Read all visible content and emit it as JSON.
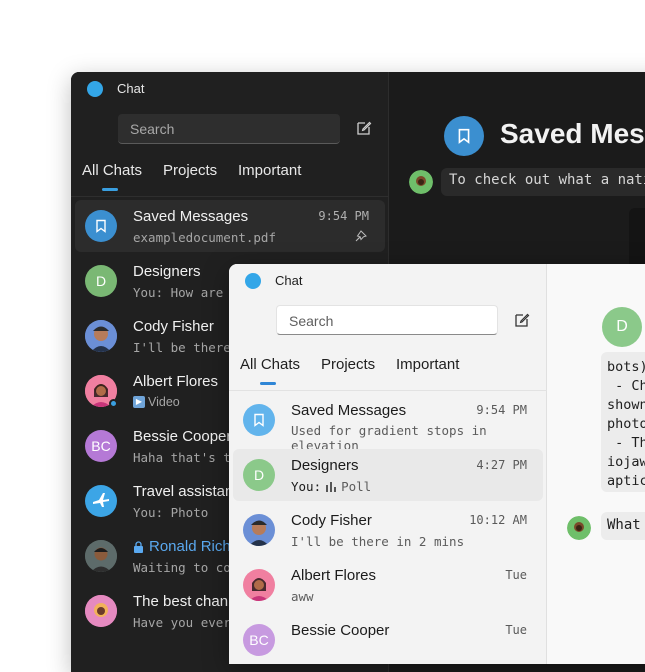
{
  "dark_window": {
    "title": "Chat",
    "search_placeholder": "Search",
    "tabs": [
      "All Chats",
      "Projects",
      "Important"
    ],
    "chats": [
      {
        "name": "Saved Messages",
        "preview": "exampledocument.pdf",
        "time": "9:54 PM"
      },
      {
        "name": "Designers",
        "preview": "You: How are y",
        "initials": "D"
      },
      {
        "name": "Cody Fisher",
        "preview": "I'll be there"
      },
      {
        "name": "Albert Flores",
        "preview": "Video"
      },
      {
        "name": "Bessie Cooper",
        "preview": "Haha that's te",
        "initials": "BC"
      },
      {
        "name": "Travel assistant",
        "preview": "You: Photo"
      },
      {
        "name": "Ronald Richa",
        "preview": "Waiting to con"
      },
      {
        "name": "The best chann",
        "preview": "Have you ever"
      }
    ],
    "chat_header_title": "Saved Messages",
    "message": "To check out what a nati"
  },
  "light_window": {
    "title": "Chat",
    "search_placeholder": "Search",
    "tabs": [
      "All Chats",
      "Projects",
      "Important"
    ],
    "chats": [
      {
        "name": "Saved Messages",
        "preview_line1": "Used for gradient stops in",
        "preview_line2": "elevation",
        "time": "9:54 PM"
      },
      {
        "name": "Designers",
        "preview": "Poll",
        "preview_prefix": "You:",
        "time": "4:27 PM",
        "initials": "D"
      },
      {
        "name": "Cody Fisher",
        "preview": "I'll be there in 2 mins",
        "time": "10:12 AM"
      },
      {
        "name": "Albert Flores",
        "preview": "aww",
        "time": "Tue"
      },
      {
        "name": "Bessie Cooper",
        "preview": "",
        "time": "Tue",
        "initials": "BC"
      }
    ],
    "chat_header_initial": "D",
    "bubble_text": "bots)\n - Ch\nshown\nphoto\n - Th\niojaw\naptic",
    "message": "What"
  },
  "colors": {
    "accent": "#33a6e8",
    "dark_bg": "#202020",
    "light_bg": "#f3f3f3"
  }
}
